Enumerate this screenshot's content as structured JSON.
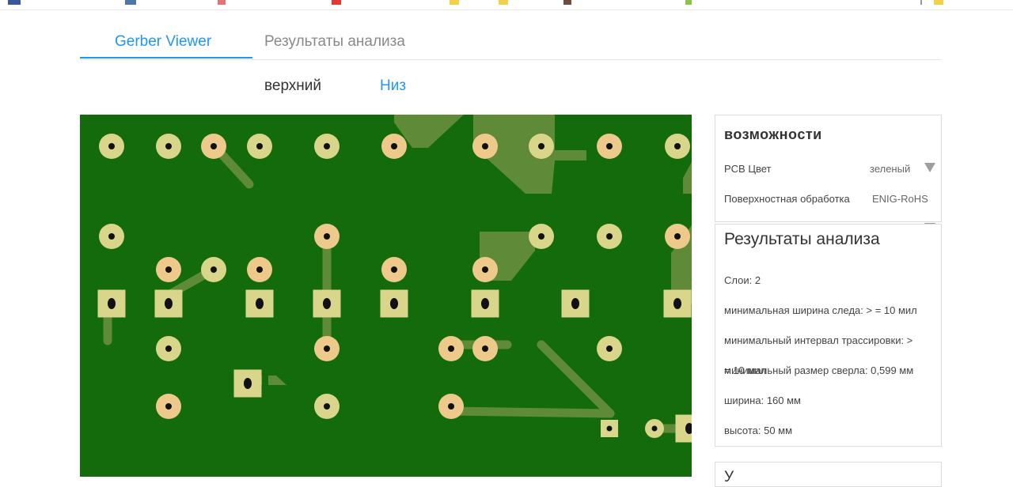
{
  "tabs": [
    {
      "label": "Gerber Viewer",
      "active": true
    },
    {
      "label": "Результаты анализа",
      "active": false
    }
  ],
  "side_switch": {
    "top": "верхний",
    "bottom": "Низ",
    "active": "bottom"
  },
  "colors": {
    "accent": "#2196f3",
    "board": "#136b0c",
    "trace": "#5f8a38",
    "pad": "#d9d58a",
    "pad_orange": "#eec98c",
    "drill": "#111111"
  },
  "features": {
    "title": "возможности",
    "pcb_color_label": "PCB Цвет",
    "pcb_color_value": "зеленый",
    "surface_label": "Поверхностная обработка",
    "surface_value": "ENIG-RoHS"
  },
  "analysis": {
    "title": "Результаты анализа",
    "layers": "Слои: 2",
    "min_trace_width": "минимальная ширина следа: > = 10 мил",
    "min_spacing_line1": "минимальный интервал трассировки: >",
    "min_spacing_line2": "= 10 мил",
    "min_drill": "минимальный размер сверла: 0,599 мм",
    "width": "ширина: 160 мм",
    "height": "высота: 50 мм"
  },
  "extra_panel": {
    "title": "У"
  }
}
